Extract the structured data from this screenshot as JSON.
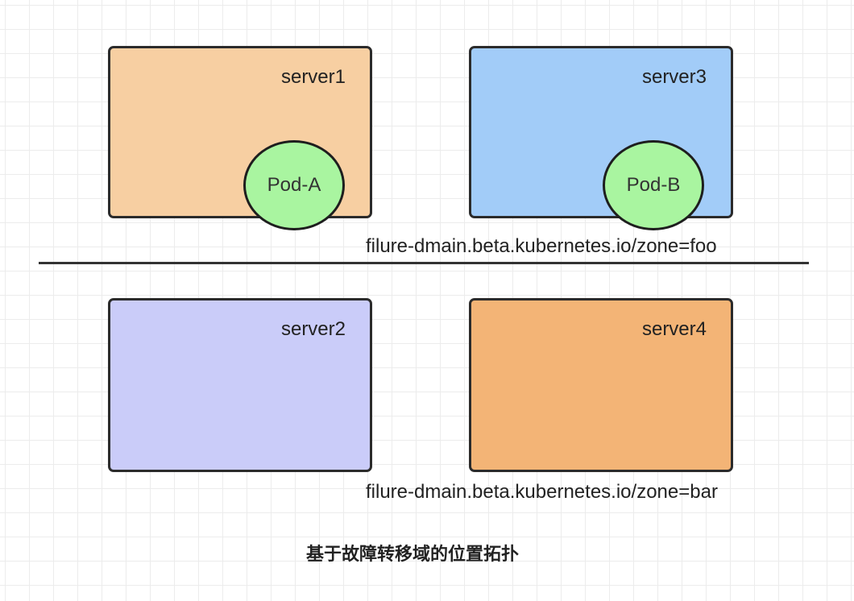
{
  "colors": {
    "server1_fill": "#F7CFA2",
    "server3_fill": "#A2CCF8",
    "server2_fill": "#CACCF9",
    "server4_fill": "#F3B476",
    "pod_fill": "#A9F5A0",
    "border": "#2B2B2B",
    "divider": "#333333"
  },
  "servers": {
    "server1": {
      "label": "server1"
    },
    "server2": {
      "label": "server2"
    },
    "server3": {
      "label": "server3"
    },
    "server4": {
      "label": "server4"
    }
  },
  "pods": {
    "pod_a": {
      "label": "Pod-A"
    },
    "pod_b": {
      "label": "Pod-B"
    }
  },
  "zones": {
    "foo": {
      "label": "filure-dmain.beta.kubernetes.io/zone=foo"
    },
    "bar": {
      "label": "filure-dmain.beta.kubernetes.io/zone=bar"
    }
  },
  "caption": "基于故障转移域的位置拓扑"
}
